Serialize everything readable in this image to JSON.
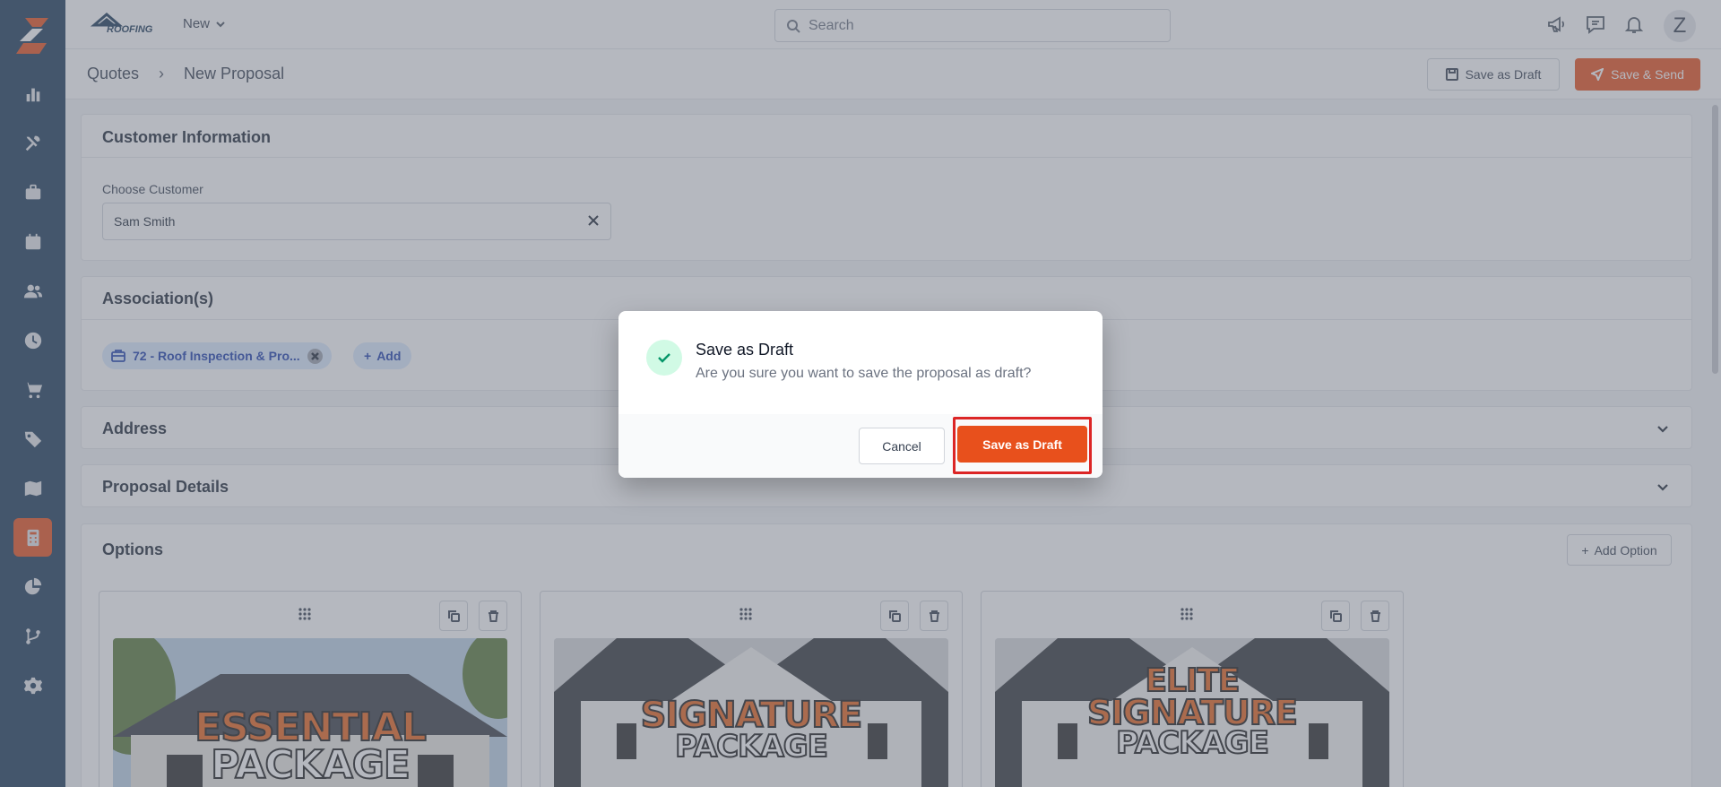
{
  "app": {
    "brand_name": "ROOFING",
    "new_menu_label": "New",
    "search_placeholder": "Search",
    "avatar_initial": "Z"
  },
  "sidebar": {
    "items": [
      {
        "icon": "bar-chart-icon"
      },
      {
        "icon": "tools-icon"
      },
      {
        "icon": "briefcase-icon"
      },
      {
        "icon": "calendar-icon"
      },
      {
        "icon": "users-icon"
      },
      {
        "icon": "clock-icon"
      },
      {
        "icon": "cart-icon"
      },
      {
        "icon": "tag-icon"
      },
      {
        "icon": "map-icon"
      },
      {
        "icon": "calculator-icon",
        "active": true
      },
      {
        "icon": "pie-chart-icon"
      },
      {
        "icon": "git-branch-icon"
      },
      {
        "icon": "gear-icon"
      }
    ]
  },
  "header": {
    "breadcrumb": [
      "Quotes",
      "New Proposal"
    ],
    "save_draft_label": "Save as Draft",
    "save_send_label": "Save & Send"
  },
  "customer": {
    "title": "Customer Information",
    "field_label": "Choose Customer",
    "value": "Sam Smith"
  },
  "associations": {
    "title": "Association(s)",
    "chip_label": "72 - Roof Inspection & Pro...",
    "add_label": "Add"
  },
  "address": {
    "title": "Address"
  },
  "proposal_details": {
    "title": "Proposal Details"
  },
  "options": {
    "title": "Options",
    "add_label": "Add Option",
    "cards": [
      {
        "line1": "ESSENTIAL",
        "line2": "PACKAGE"
      },
      {
        "line1": "SIGNATURE",
        "line2": "PACKAGE"
      },
      {
        "line0": "ELITE",
        "line1": "SIGNATURE",
        "line2": "PACKAGE"
      }
    ]
  },
  "modal": {
    "title": "Save as Draft",
    "message": "Are you sure you want to save the proposal as draft?",
    "cancel_label": "Cancel",
    "confirm_label": "Save as Draft"
  },
  "colors": {
    "accent": "#e8501c",
    "sidebar": "#1c3a58",
    "chip_bg": "#dbeafe",
    "highlight": "#dc2626"
  }
}
